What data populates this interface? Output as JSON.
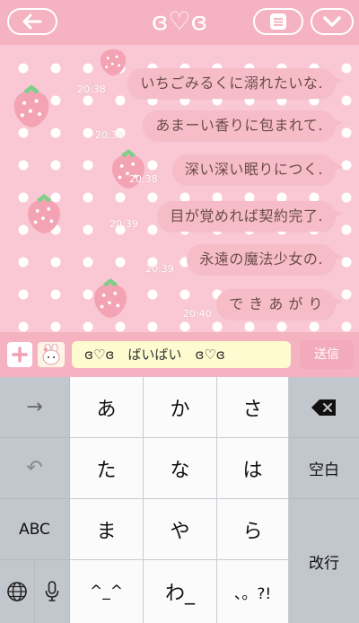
{
  "header": {
    "title": "ɞ♡ɞ",
    "back_icon": "arrow-left-icon",
    "menu_icon": "list-icon",
    "collapse_icon": "chevron-down-icon"
  },
  "messages": [
    {
      "text": "いちごみるくに溺れたいな.",
      "time": ""
    },
    {
      "text": "あまーい香りに包まれて.",
      "time": "20:38"
    },
    {
      "text": "深い深い眠りにつく.",
      "time": "20:38"
    },
    {
      "text": "目が覚めれば契約完了.",
      "time": "20:38"
    },
    {
      "text": "永遠の魔法少女の.",
      "time": "20:39"
    },
    {
      "text": "で き あ が り",
      "time": "20:39"
    }
  ],
  "last_time": "20:40",
  "input": {
    "value": "ɞ♡ɞ　ばいばい　ɞ♡ɞ",
    "send_label": "送信",
    "plus_label": "+"
  },
  "keyboard": {
    "rows": [
      [
        "あ",
        "か",
        "さ"
      ],
      [
        "た",
        "な",
        "は"
      ],
      [
        "ま",
        "や",
        "ら"
      ],
      [
        "^_^",
        "わ_",
        "、。?!"
      ]
    ],
    "left_keys": {
      "next": "→",
      "undo": "↶",
      "abc": "ABC"
    },
    "right_keys": {
      "space": "空白",
      "return": "改行"
    },
    "delete_icon": "delete-icon",
    "globe_icon": "globe-icon",
    "mic_icon": "mic-icon"
  },
  "colors": {
    "header": "#f5b3c1",
    "bubble": "#f6bcc8",
    "chat_bg": "#f9c8d4",
    "input_field": "#fffbd0"
  }
}
